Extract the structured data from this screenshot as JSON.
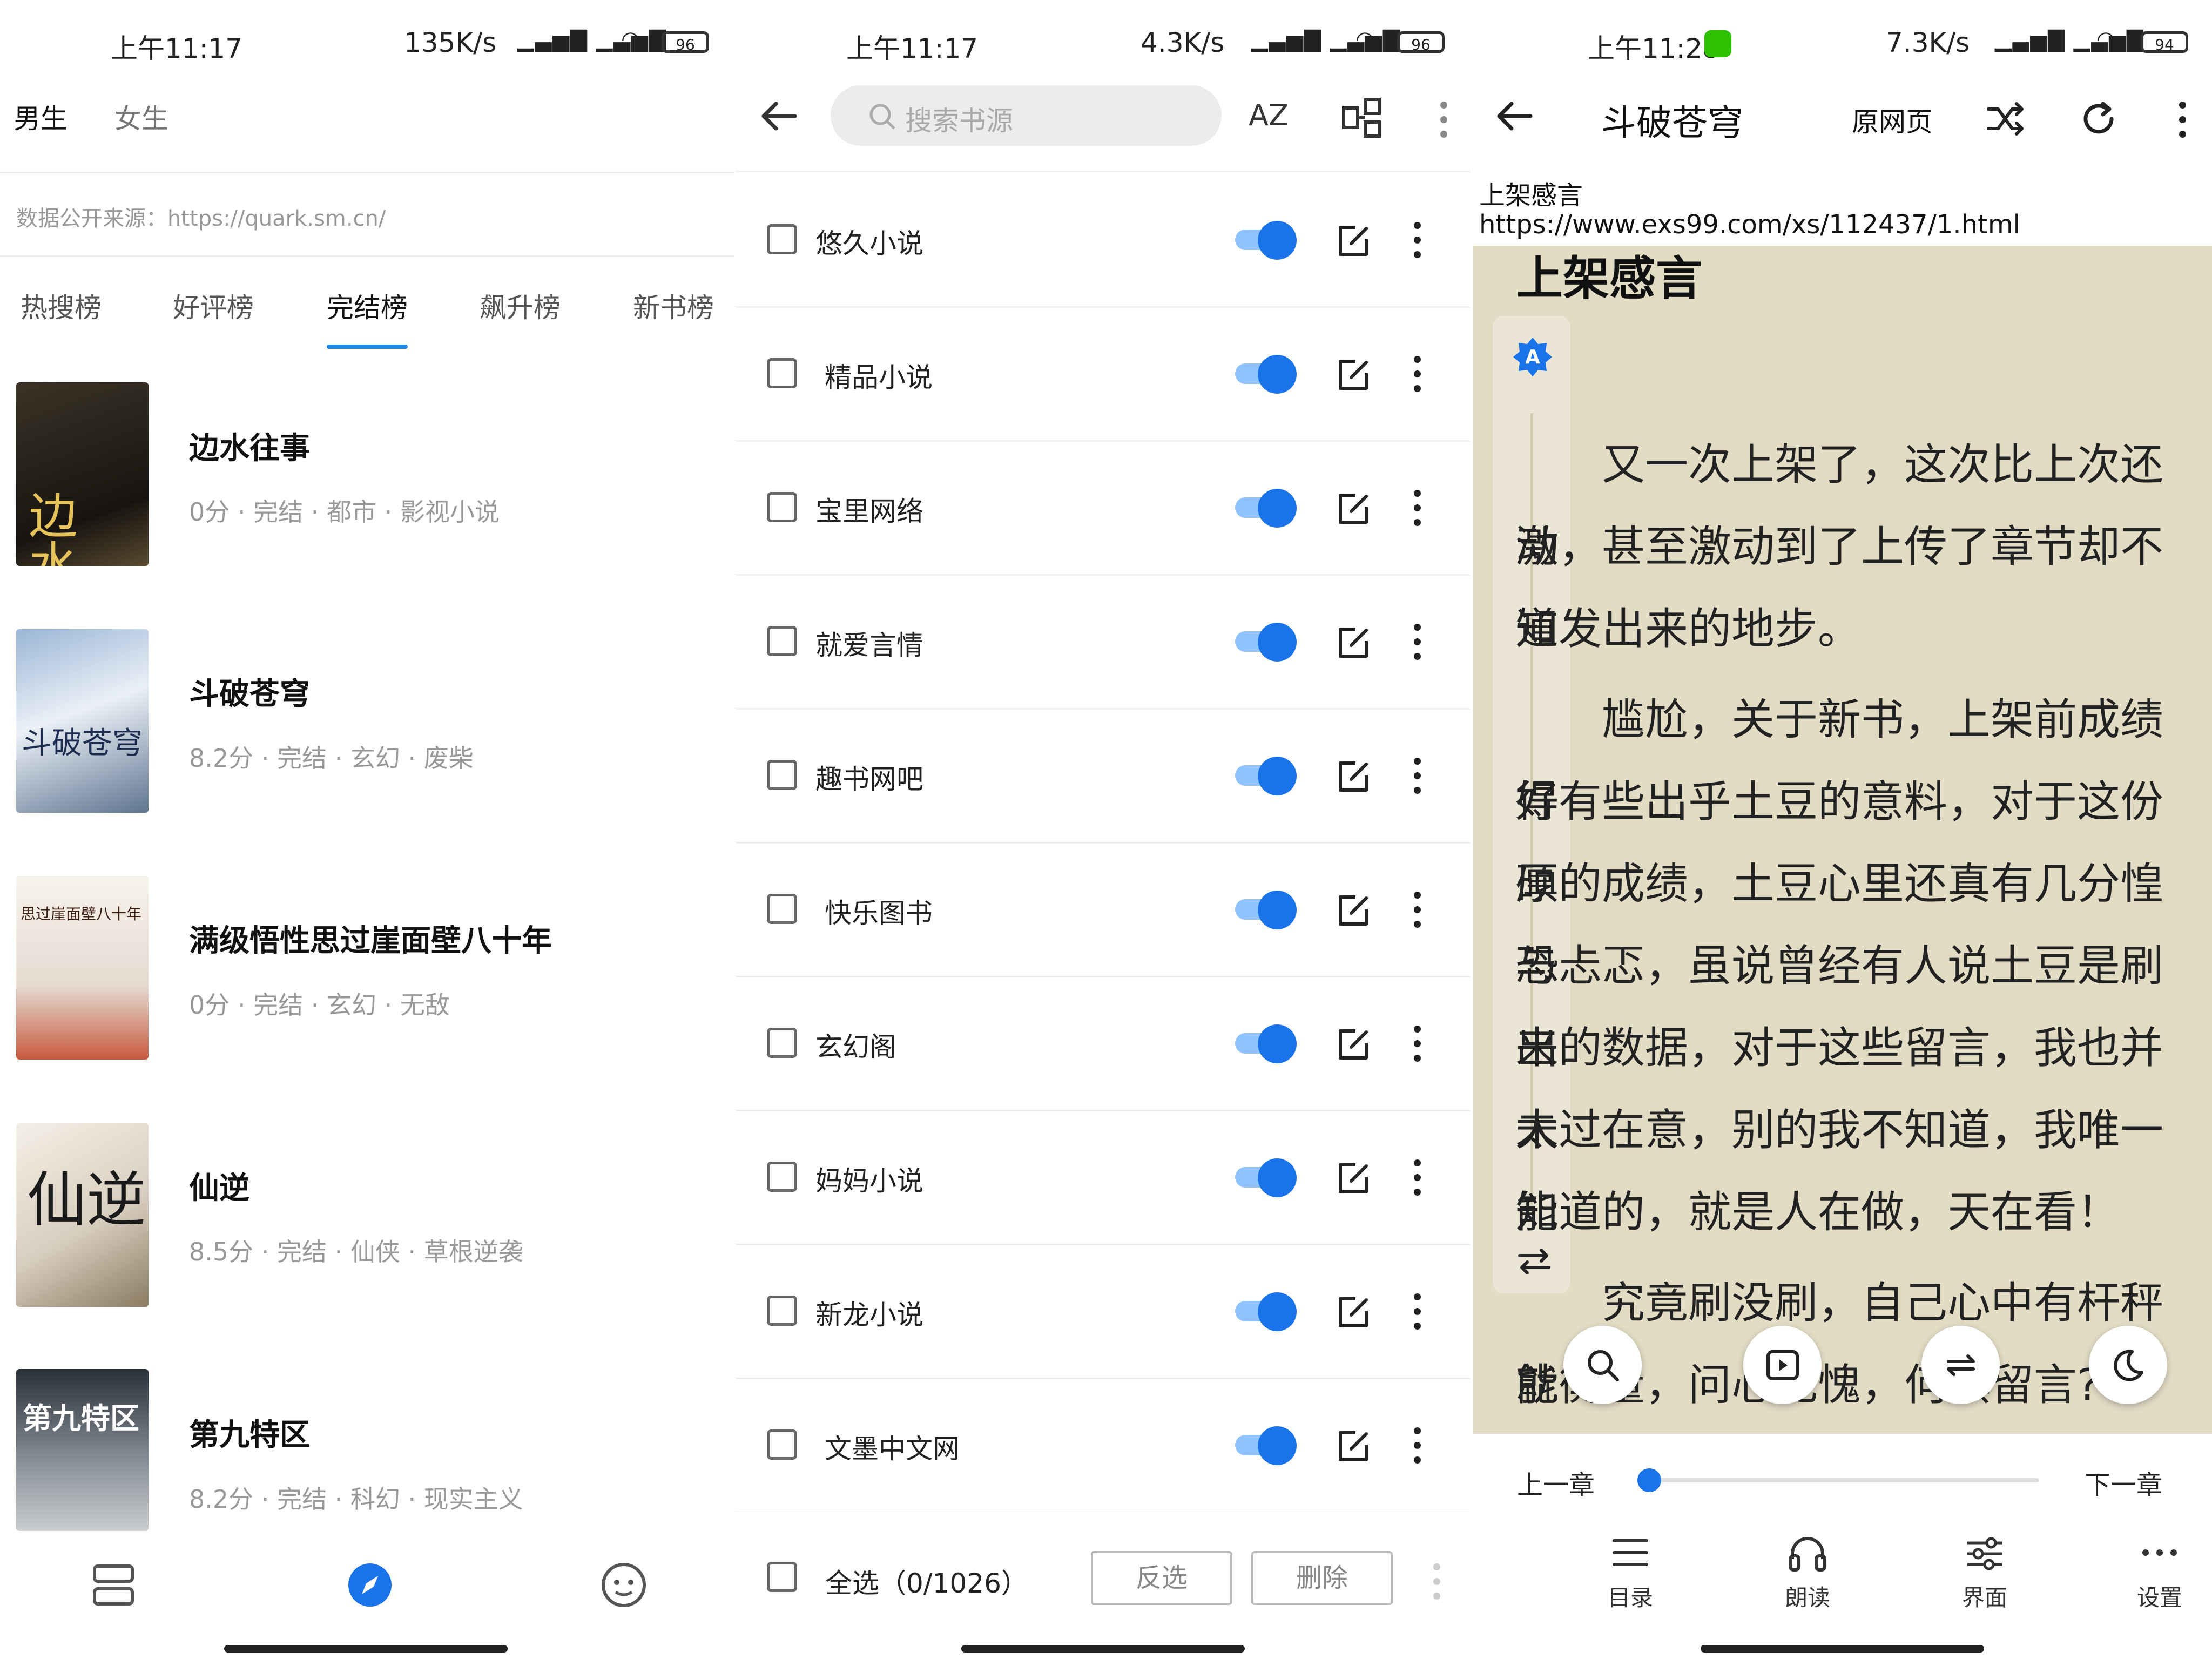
{
  "panel1": {
    "status": {
      "time": "上午11:17",
      "net": "135K/s",
      "battery": "96"
    },
    "genders": [
      "男生",
      "女生"
    ],
    "source_note": "数据公开来源：https://quark.sm.cn/",
    "tabs": [
      "热搜榜",
      "好评榜",
      "完结榜",
      "飙升榜",
      "新书榜"
    ],
    "active_tab": "完结榜",
    "books": [
      {
        "title": "边水往事",
        "meta": "0分 · 完结 · 都市 · 影视小说",
        "cover_text": "边水往事"
      },
      {
        "title": "斗破苍穹",
        "meta": "8.2分 · 完结 · 玄幻 · 废柴",
        "cover_text": "斗破苍穹"
      },
      {
        "title": "满级悟性思过崖面壁八十年",
        "meta": "0分 · 完结 · 玄幻 · 无敌",
        "cover_text": "思过崖面壁八十年"
      },
      {
        "title": "仙逆",
        "meta": "8.5分 · 完结 · 仙侠 · 草根逆袭",
        "cover_text": "仙逆"
      },
      {
        "title": "第九特区",
        "meta": "8.2分 · 完结 · 科幻 · 现实主义",
        "cover_text": "第九特区"
      }
    ],
    "nav_icons": [
      "bookshelf-icon",
      "discover-icon",
      "profile-icon"
    ]
  },
  "panel2": {
    "status": {
      "time": "上午11:17",
      "net": "4.3K/s",
      "battery": "96"
    },
    "search_placeholder": "搜索书源",
    "sort_label": "AZ",
    "sources": [
      "悠久小说",
      "精品小说",
      "宝里网络",
      "就爱言情",
      "趣书网吧",
      "快乐图书",
      "玄幻阁",
      "妈妈小说",
      "新龙小说",
      "文墨中文网"
    ],
    "select_all": "全选（0/1026）",
    "invert_label": "反选",
    "delete_label": "删除"
  },
  "panel3": {
    "status": {
      "time": "上午11:28",
      "net": "7.3K/s",
      "battery": "94"
    },
    "book_title": "斗破苍穹",
    "original_page": "原网页",
    "chapter_name": "上架感言",
    "chapter_url": "https://www.exs99.com/xs/112437/1.html",
    "heading": "上架感言",
    "font_badge": "A",
    "lines": [
      "　　又一次上架了，这次比上次还激",
      "动，甚至激动到了上传了章节却不知",
      "道发出来的地步。",
      "　　尴尬，关于新书，上架前成绩好",
      "得有些出乎土豆的意料，对于这份厚",
      "硕的成绩，土豆心里还真有几分惶恐",
      "与忐忑，虽说曾经有人说土豆是刷出",
      "来的数据，对于这些留言，我也并未",
      "太过在意，别的我不知道，我唯一能",
      "知道的，就是人在做，天在看！",
      "　　究竟刷没刷，自己心中有杆秤就",
      "能衡量，问心无愧，何惧留言?"
    ],
    "prev_chapter": "上一章",
    "next_chapter": "下一章",
    "progress": 0.0,
    "tools": [
      "目录",
      "朗读",
      "界面",
      "设置"
    ],
    "accent": "#1a73e8"
  }
}
